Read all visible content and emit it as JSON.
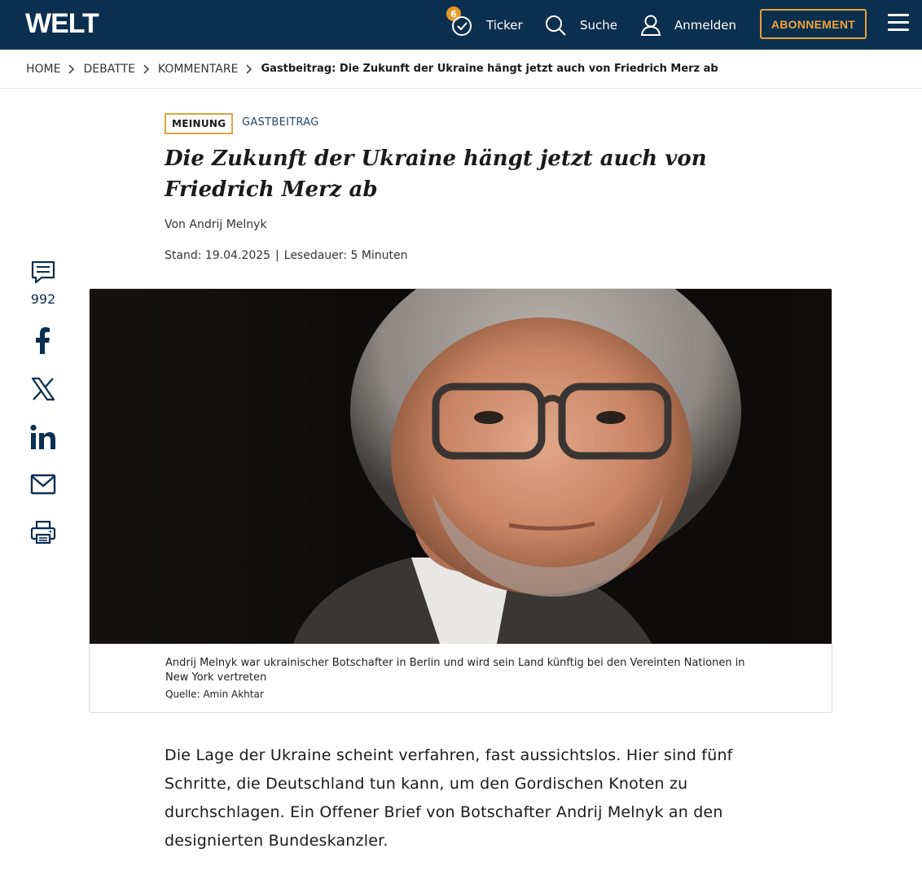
{
  "header": {
    "logo": "WELT",
    "ticker_label": "Ticker",
    "ticker_badge": "6",
    "search_label": "Suche",
    "login_label": "Anmelden",
    "subscribe_label": "ABONNEMENT",
    "colors": {
      "bar": "#0b2f4f",
      "accent": "#e69a2b"
    }
  },
  "breadcrumb": {
    "items": [
      "HOME",
      "DEBATTE",
      "KOMMENTARE"
    ],
    "current": "Gastbeitrag: Die Zukunft der Ukraine hängt jetzt auch von Friedrich Merz ab"
  },
  "article": {
    "tag_opinion": "MEINUNG",
    "tag_type": "GASTBEITRAG",
    "headline": "Die Zukunft der Ukraine hängt jetzt auch von Friedrich Merz ab",
    "author": "Von Andrij Melnyk",
    "date_label": "Stand: 19.04.2025",
    "meta_separator": "|",
    "reading_time": "Lesedauer: 5 Minuten",
    "image_caption": "Andrij Melnyk war ukrainischer Botschafter in Berlin und wird sein Land künftig bei den Vereinten Nationen in New York vertreten",
    "image_source": "Quelle: Amin Akhtar",
    "lead": "Die Lage der Ukraine scheint verfahren, fast aussichtslos. Hier sind fünf Schritte, die Deutschland tun kann, um den Gordischen Knoten zu durchschlagen. Ein Offener Brief von Botschafter Andrij Melnyk an den designierten Bundeskanzler."
  },
  "share": {
    "comment_count": "992",
    "icons": [
      "comment-icon",
      "facebook-icon",
      "x-icon",
      "linkedin-icon",
      "mail-icon",
      "print-icon"
    ]
  }
}
